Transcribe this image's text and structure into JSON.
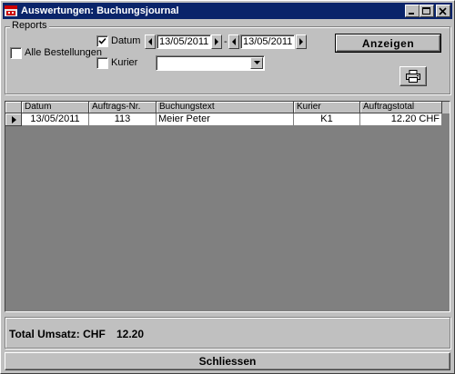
{
  "window": {
    "title": "Auswertungen: Buchungsjournal",
    "title_bar_color": "#0a246a"
  },
  "reports": {
    "group_label": "Reports",
    "alle_bestellungen": {
      "label": "Alle Bestellungen",
      "checked": false
    },
    "datum": {
      "label": "Datum",
      "checked": true,
      "from": "13/05/2011",
      "to": "13/05/2011",
      "separator": "-"
    },
    "kurier": {
      "label": "Kurier",
      "checked": false,
      "selected": ""
    },
    "anzeigen_label": "Anzeigen",
    "print_icon": "printer-icon"
  },
  "grid": {
    "columns": [
      "Datum",
      "Auftrags-Nr.",
      "Buchungstext",
      "Kurier",
      "Auftragstotal"
    ],
    "rows": [
      {
        "datum": "13/05/2011",
        "auftrags_nr": "113",
        "buchungstext": "Meier Peter",
        "kurier": "K1",
        "auftragstotal": "12.20 CHF"
      }
    ]
  },
  "total": {
    "label": "Total Umsatz: CHF",
    "value": "12.20"
  },
  "close_label": "Schliessen"
}
